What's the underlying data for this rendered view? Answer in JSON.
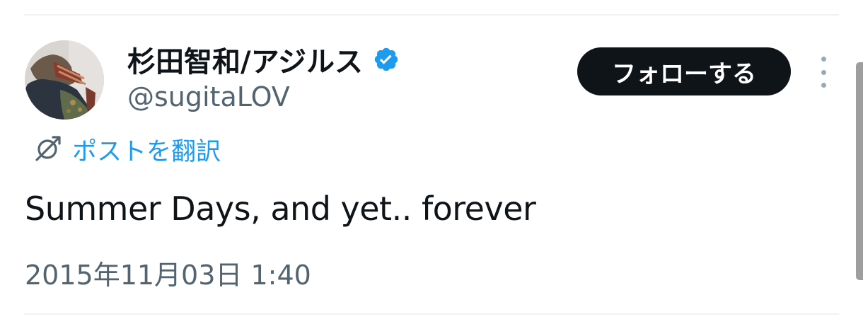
{
  "author": {
    "display_name": "杉田智和/アジルス",
    "handle": "@sugitaLOV",
    "verified": true,
    "verified_color": "#1d9bf0"
  },
  "actions": {
    "follow_label": "フォローする",
    "more_icon": "more-vertical-icon"
  },
  "translate": {
    "icon": "translate-icon",
    "label": "ポストを翻訳"
  },
  "tweet": {
    "text": "Summer Days, and yet.. forever",
    "timestamp": "2015年11月03日 1:40"
  },
  "colors": {
    "text_primary": "#0f1419",
    "text_secondary": "#536471",
    "accent": "#1d9bf0",
    "button_bg": "#0f1419",
    "divider": "#eff3f4"
  }
}
